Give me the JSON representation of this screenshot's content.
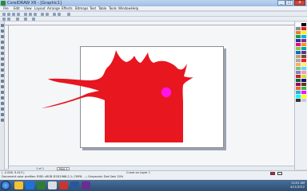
{
  "window": {
    "title": "CorelDRAW X6 - [Graphic1]",
    "min_label": "_",
    "max_label": "□",
    "close_label": "x"
  },
  "menu": [
    "File",
    "Edit",
    "View",
    "Layout",
    "Arrange",
    "Effects",
    "Bitmaps",
    "Text",
    "Table",
    "Tools",
    "Window",
    "Help"
  ],
  "document": {
    "page_tab_label": "Page 1",
    "page_counter": "1 of 1"
  },
  "status": {
    "top_line": "Curve on Layer 1",
    "bottom_line": "Document color profiles: RGB: sRGB IEC61966-2.1; CMYK: ...; Grayscale: Dot Gain 20%",
    "coords": "( -2.028, 9.413 )"
  },
  "artwork": {
    "shape_color": "#e8161f",
    "circle_color": "#ff14e8"
  },
  "palette_colors": [
    "#ffffff",
    "#000000",
    "#8a8a8a",
    "#e31b23",
    "#f47a20",
    "#fff200",
    "#00a651",
    "#00aeef",
    "#2e3192",
    "#92278f",
    "#ec008c",
    "#f7941d",
    "#8dc63f",
    "#00a99d",
    "#0072bc",
    "#662d91",
    "#c69c6d",
    "#754c24",
    "#a8a8a8",
    "#ed1c24",
    "#fbaf5d",
    "#fff568",
    "#7cc576",
    "#6dcff6",
    "#8781bd",
    "#f49ac1",
    "#c1272d",
    "#d9e021",
    "#006837",
    "#1b1464",
    "#9e005d",
    "#603813",
    "#f26522",
    "#39b54a",
    "#29abe2",
    "#ff00ff",
    "#00ffff",
    "#ffff00",
    "#333333",
    "#cccccc"
  ],
  "tray": {
    "time": "12:01 AM",
    "date": "4/11/2012"
  }
}
